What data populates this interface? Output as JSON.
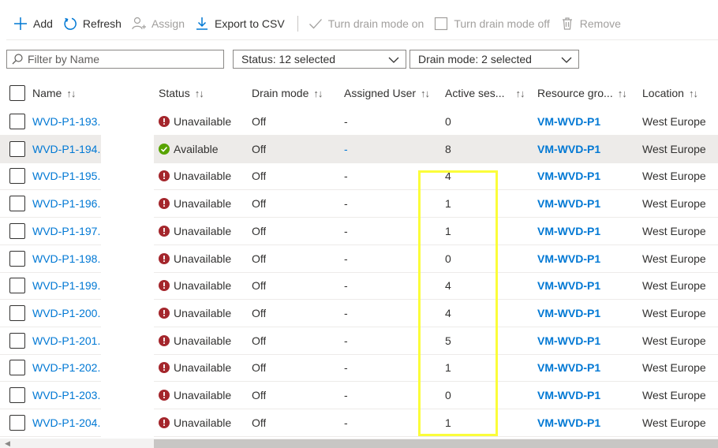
{
  "toolbar": {
    "add": "Add",
    "refresh": "Refresh",
    "assign": "Assign",
    "export": "Export to CSV",
    "drain_on": "Turn drain mode on",
    "drain_off": "Turn drain mode off",
    "remove": "Remove"
  },
  "filters": {
    "search_placeholder": "Filter by Name",
    "status": "Status: 12 selected",
    "drain": "Drain mode: 2 selected"
  },
  "columns": {
    "name": "Name",
    "status": "Status",
    "drain": "Drain mode",
    "user": "Assigned User",
    "sessions": "Active ses...",
    "rg": "Resource gro...",
    "location": "Location"
  },
  "colors": {
    "link": "#0078d4",
    "error": "#a4262c",
    "success": "#57a300",
    "highlight": "#fbfd3a"
  },
  "rows": [
    {
      "name": "WVD-P1-193.",
      "status": "Unavailable",
      "drain": "Off",
      "user": "-",
      "sessions": "0",
      "rg": "VM-WVD-P1",
      "location": "West Europe"
    },
    {
      "name": "WVD-P1-194.",
      "status": "Available",
      "drain": "Off",
      "user": "-",
      "sessions": "8",
      "rg": "VM-WVD-P1",
      "location": "West Europe"
    },
    {
      "name": "WVD-P1-195.",
      "status": "Unavailable",
      "drain": "Off",
      "user": "-",
      "sessions": "4",
      "rg": "VM-WVD-P1",
      "location": "West Europe"
    },
    {
      "name": "WVD-P1-196.",
      "status": "Unavailable",
      "drain": "Off",
      "user": "-",
      "sessions": "1",
      "rg": "VM-WVD-P1",
      "location": "West Europe"
    },
    {
      "name": "WVD-P1-197.",
      "status": "Unavailable",
      "drain": "Off",
      "user": "-",
      "sessions": "1",
      "rg": "VM-WVD-P1",
      "location": "West Europe"
    },
    {
      "name": "WVD-P1-198.",
      "status": "Unavailable",
      "drain": "Off",
      "user": "-",
      "sessions": "0",
      "rg": "VM-WVD-P1",
      "location": "West Europe"
    },
    {
      "name": "WVD-P1-199.",
      "status": "Unavailable",
      "drain": "Off",
      "user": "-",
      "sessions": "4",
      "rg": "VM-WVD-P1",
      "location": "West Europe"
    },
    {
      "name": "WVD-P1-200.",
      "status": "Unavailable",
      "drain": "Off",
      "user": "-",
      "sessions": "4",
      "rg": "VM-WVD-P1",
      "location": "West Europe"
    },
    {
      "name": "WVD-P1-201.",
      "status": "Unavailable",
      "drain": "Off",
      "user": "-",
      "sessions": "5",
      "rg": "VM-WVD-P1",
      "location": "West Europe"
    },
    {
      "name": "WVD-P1-202.",
      "status": "Unavailable",
      "drain": "Off",
      "user": "-",
      "sessions": "1",
      "rg": "VM-WVD-P1",
      "location": "West Europe"
    },
    {
      "name": "WVD-P1-203.",
      "status": "Unavailable",
      "drain": "Off",
      "user": "-",
      "sessions": "0",
      "rg": "VM-WVD-P1",
      "location": "West Europe"
    },
    {
      "name": "WVD-P1-204.",
      "status": "Unavailable",
      "drain": "Off",
      "user": "-",
      "sessions": "1",
      "rg": "VM-WVD-P1",
      "location": "West Europe"
    }
  ]
}
